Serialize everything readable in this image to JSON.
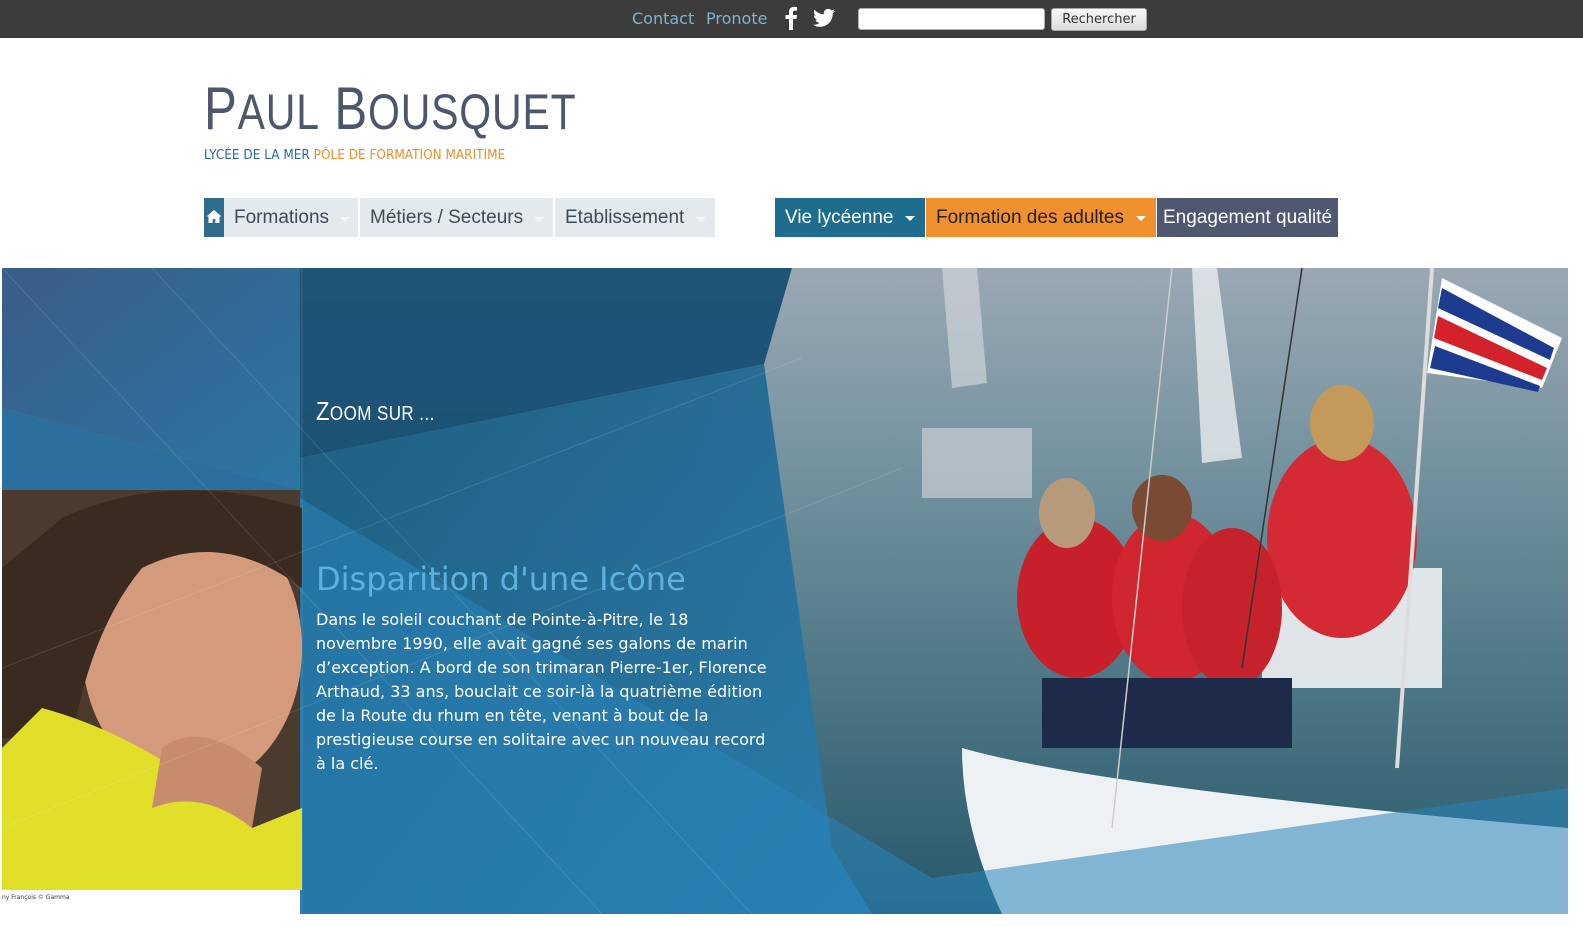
{
  "topbar": {
    "contact": "Contact",
    "pronote": "Pronote",
    "search_placeholder": "",
    "search_button": "Rechercher",
    "social_icons": [
      "facebook-icon",
      "twitter-icon"
    ]
  },
  "logo": {
    "name_initial_1": "P",
    "name_rest_1": "AUL",
    "name_initial_2": "B",
    "name_rest_2": "OUSQUET",
    "tagline_part1": "LYCÉE DE LA MER",
    "tagline_part2": "PÔLE DE FORMATION MARITIME"
  },
  "nav": {
    "home_icon": "home-icon",
    "formations": "Formations",
    "metiers": "Métiers / Secteurs",
    "etablissement": "Etablissement",
    "vie_lyceenne": "Vie lycéenne",
    "formation_adultes": "Formation des adultes",
    "engagement_qualite": "Engagement qualité"
  },
  "hero": {
    "zoom_initial": "Z",
    "zoom_rest": "OOM SUR ...",
    "article_title": "Disparition d'une Icône",
    "article_text": "Dans le soleil couchant de Pointe-à-Pitre, le 18 novembre 1990, elle avait gagné ses galons de marin d’exception. A bord de son trimaran Pierre-1er, Florence Arthaud, 33 ans, bouclait ce soir-là la quatrième édition de la Route du rhum en tête, venant à bout de la prestigieuse course en solitaire avec un nouveau record à la clé.",
    "photo_credit": "ny François © Gamma"
  },
  "colors": {
    "topbar_bg": "#3c3c3c",
    "link": "#7fb3d1",
    "nav_light": "#e4e9ee",
    "nav_teal": "#1e6d8e",
    "nav_orange": "#f0902f",
    "nav_slate": "#4f5870",
    "title_blue": "#5fb0de"
  }
}
